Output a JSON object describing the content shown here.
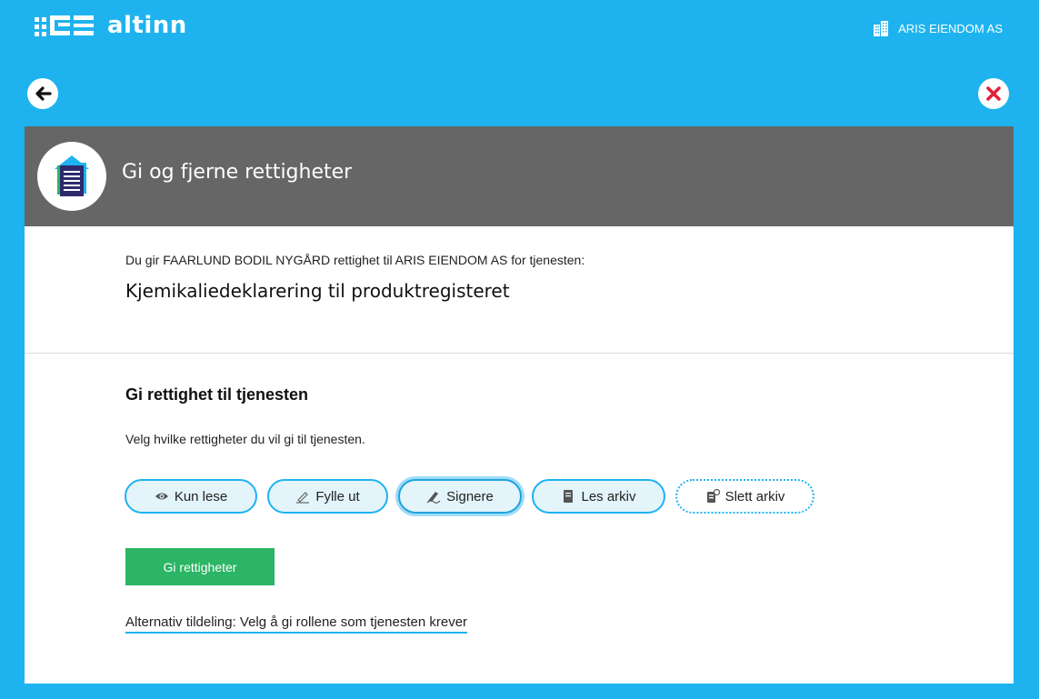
{
  "brand": {
    "name": "altinn",
    "logo_icon": "altinn-logo-mark"
  },
  "header": {
    "organization": "ARIS EIENDOM AS",
    "organization_icon": "building-icon"
  },
  "nav": {
    "back_icon": "arrow-left-icon",
    "close_icon": "close-icon"
  },
  "page": {
    "title": "Gi og fjerne rettigheter",
    "header_icon": "document-icon",
    "intro": "Du gir FAARLUND BODIL NYGÅRD rettighet til ARIS EIENDOM AS for tjenesten:",
    "service_name": "Kjemikaliedeklarering til produktregisteret"
  },
  "section": {
    "title": "Gi rettighet til tjenesten",
    "description": "Velg hvilke rettigheter du vil gi til tjenesten.",
    "rights": [
      {
        "label": "Kun lese",
        "icon": "eye-icon",
        "state": "active"
      },
      {
        "label": "Fylle ut",
        "icon": "pencil-icon",
        "state": "active"
      },
      {
        "label": "Signere",
        "icon": "signature-icon",
        "state": "selected"
      },
      {
        "label": "Les arkiv",
        "icon": "archive-icon",
        "state": "active"
      },
      {
        "label": "Slett arkiv",
        "icon": "archive-delete-icon",
        "state": "inactive"
      }
    ],
    "submit_label": "Gi rettigheter",
    "alternative_link": "Alternativ tildeling: Velg å gi rollene som tjenesten krever"
  },
  "colors": {
    "background": "#1eb3ef",
    "header_gray": "#666666",
    "primary_green": "#2bb564",
    "close_red": "#e3203a"
  }
}
